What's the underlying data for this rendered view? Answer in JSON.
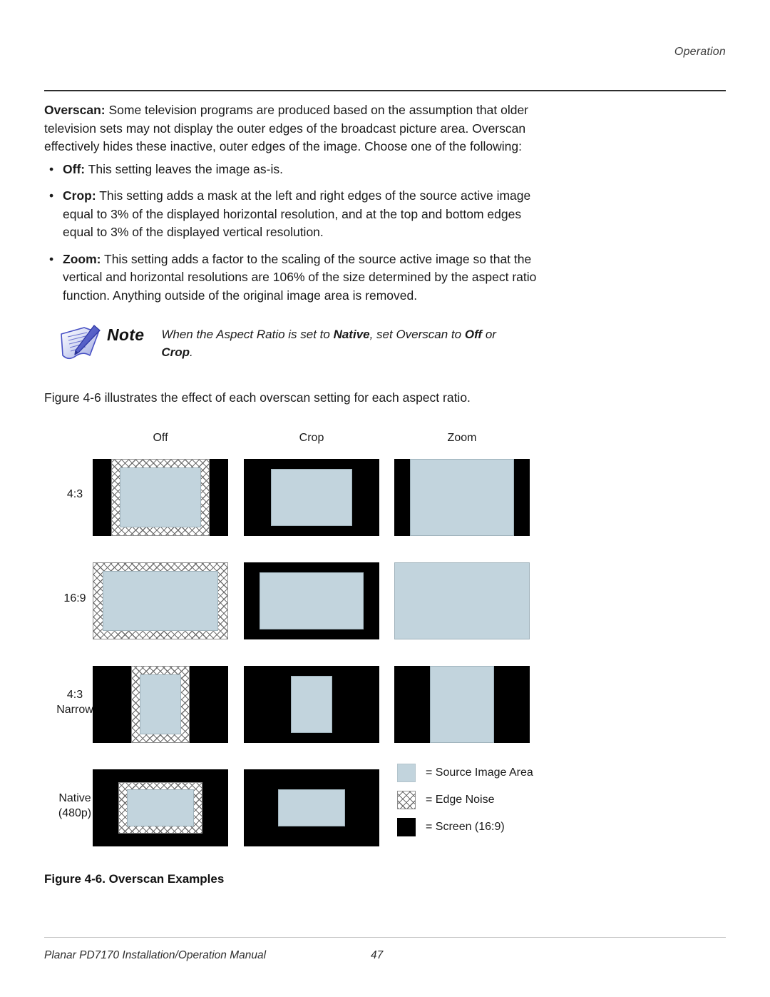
{
  "header": {
    "running_head": "Operation"
  },
  "body": {
    "intro_bold": "Overscan:",
    "intro_rest": " Some television programs are produced based on the assumption that older television sets may not display the outer edges of the broadcast picture area. Overscan effectively hides these inactive, outer edges of the image. Choose one of the following:",
    "bullets": [
      {
        "marker": "•",
        "term": "Off:",
        "text": " This setting leaves the image as-is."
      },
      {
        "marker": "•",
        "term": "Crop:",
        "text": " This setting adds a mask at the left and right edges of the source active image equal to 3% of the displayed horizontal resolution, and at the top and bottom edges equal to 3% of the displayed vertical resolution."
      },
      {
        "marker": "•",
        "term": "Zoom:",
        "text": " This setting adds a factor to the scaling of the source active image so that the vertical and horizontal resolutions are 106% of the size determined by the aspect ratio function. Anything outside of the original image area is removed."
      }
    ]
  },
  "note": {
    "icon": "note-pen-paper-icon",
    "label": "Note",
    "text_part_1": "When the Aspect Ratio is set to ",
    "text_bold_1": "Native",
    "text_part_2": ", set Overscan to ",
    "text_bold_2": "Off",
    "text_part_3": " or ",
    "text_bold_3": "Crop",
    "text_part_4": "."
  },
  "figure_intro": "Figure 4-6 illustrates the effect of each overscan setting for each aspect ratio.",
  "figure": {
    "column_headers": [
      "Off",
      "Crop",
      "Zoom"
    ],
    "row_labels": [
      "4:3",
      "16:9",
      "4:3 Narrow",
      "Native (480p)"
    ],
    "row_labels_multiline": [
      [
        "4:3"
      ],
      [
        "16:9"
      ],
      [
        "4:3",
        "Narrow"
      ],
      [
        "Native",
        "(480p)"
      ]
    ],
    "legend": [
      {
        "swatch": "source-image-area-swatch",
        "label": "= Source Image Area"
      },
      {
        "swatch": "edge-noise-swatch",
        "label": "= Edge Noise"
      },
      {
        "swatch": "screen-swatch",
        "label": "= Screen (16:9)"
      }
    ],
    "colors": {
      "source_image_area": "#c2d4dd",
      "screen": "#000000",
      "edge_noise_line": "#6f6f6f",
      "edge_noise_bg": "#ffffff"
    }
  },
  "caption": "Figure 4-6. Overscan Examples",
  "footer": {
    "manual": "Planar PD7170 Installation/Operation Manual",
    "page": "47"
  }
}
